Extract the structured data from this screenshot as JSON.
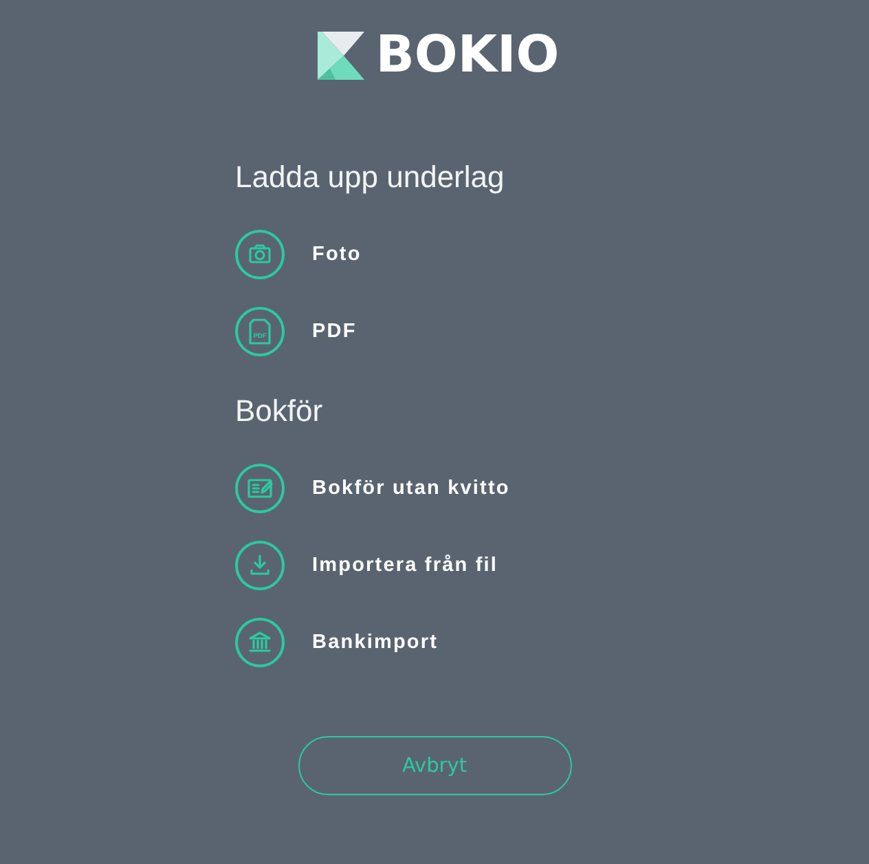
{
  "logo": {
    "text": "BOKIO"
  },
  "sections": [
    {
      "title": "Ladda upp underlag",
      "items": [
        {
          "label": "Foto",
          "kind": "camera"
        },
        {
          "label": "PDF",
          "kind": "pdf",
          "icon_text": "PDF"
        }
      ]
    },
    {
      "title": "Bokför",
      "items": [
        {
          "label": "Bokför utan kvitto",
          "kind": "manual"
        },
        {
          "label": "Importera från fil",
          "kind": "import"
        },
        {
          "label": "Bankimport",
          "kind": "bank"
        }
      ]
    }
  ],
  "cancel_button": {
    "label": "Avbryt"
  }
}
